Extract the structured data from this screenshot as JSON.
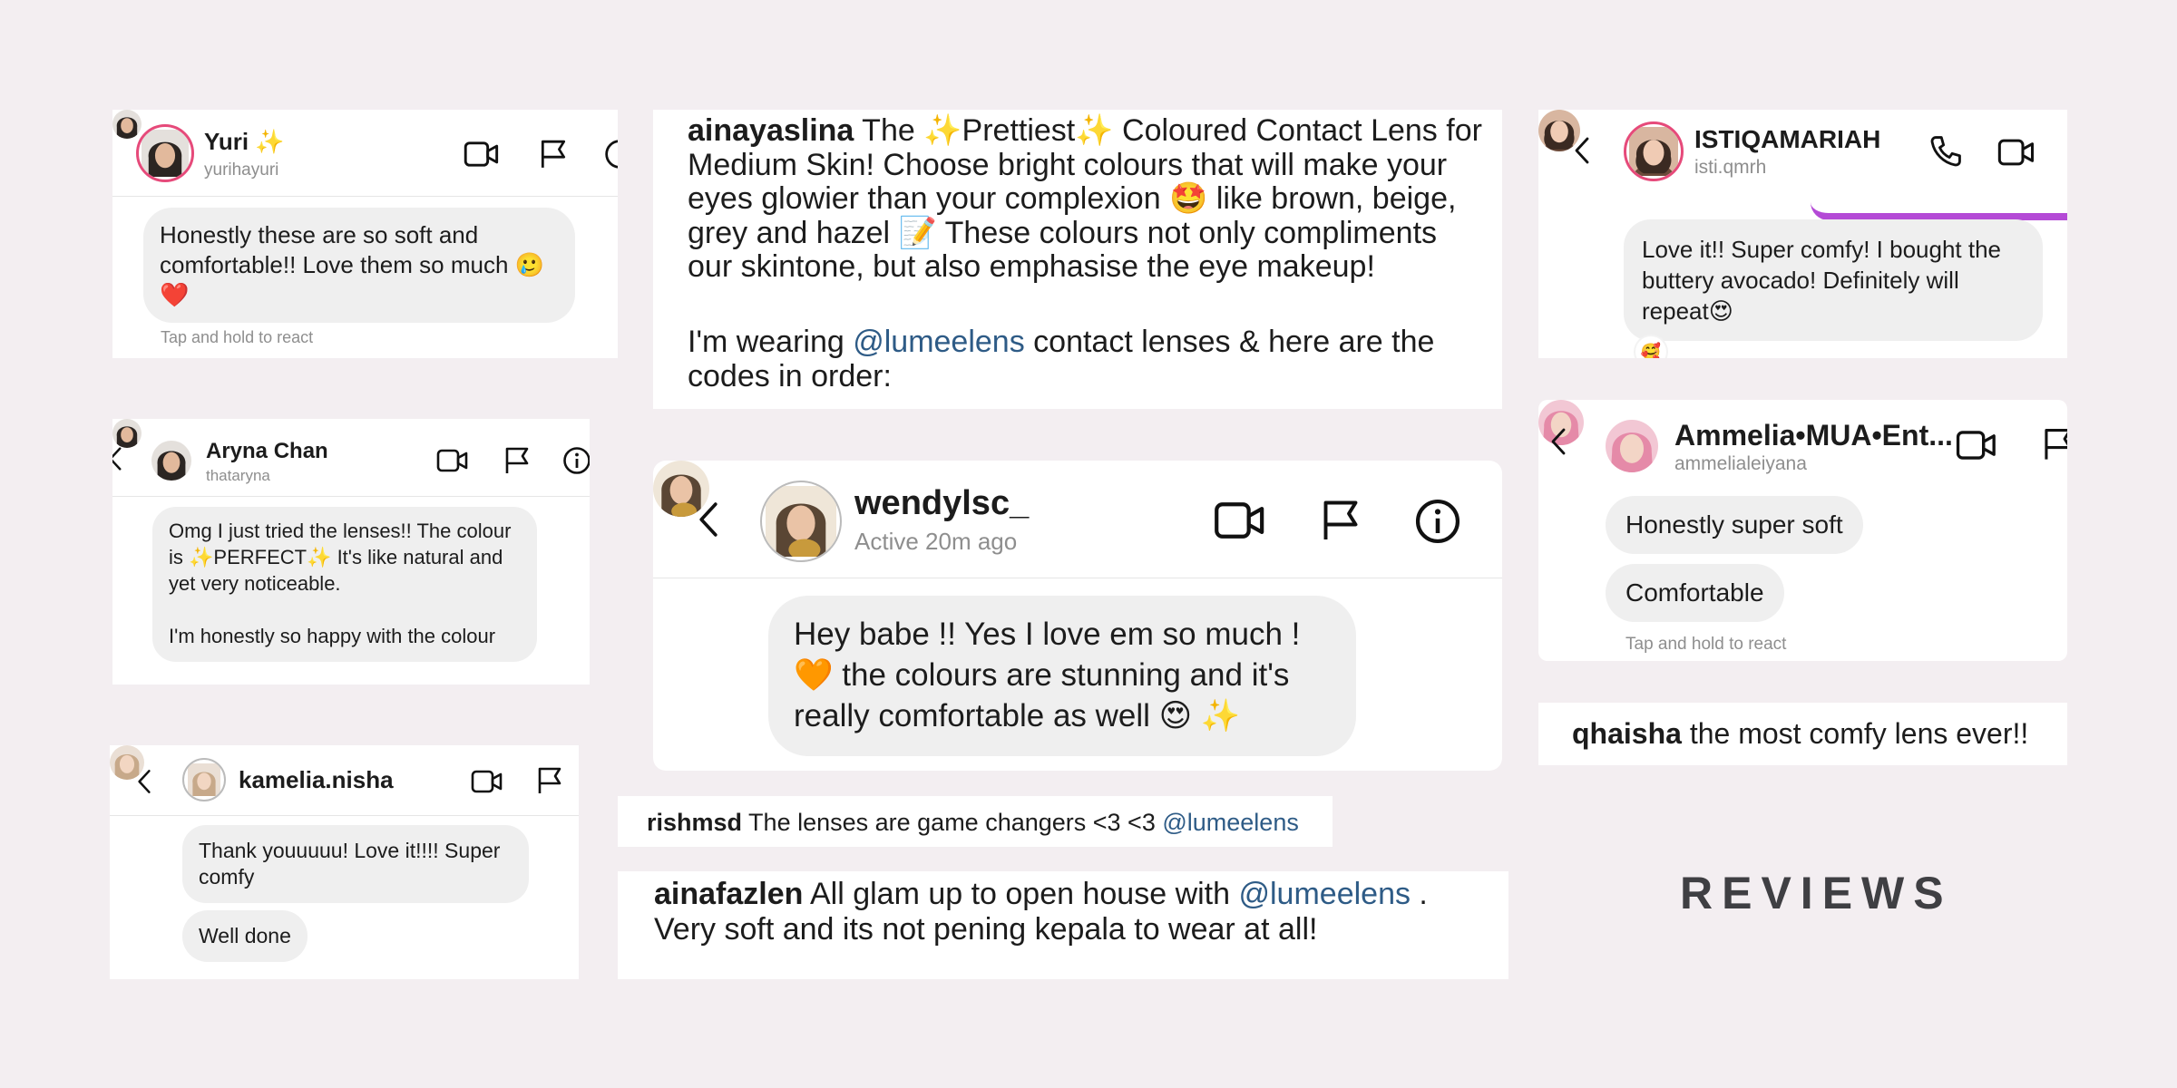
{
  "title": "REVIEWS",
  "yuri": {
    "name": "Yuri ✨",
    "handle": "yurihayuri",
    "message": "Honestly these are so soft and comfortable!! Love them so much 🥲 ❤️",
    "react_hint": "Tap and hold to react"
  },
  "aryna": {
    "name": "Aryna Chan",
    "handle": "thataryna",
    "message": "Omg I just tried the lenses!! The colour is ✨PERFECT✨ It's like natural and yet very noticeable.\n\nI'm honestly so happy with the colour"
  },
  "kamelia": {
    "name": "kamelia.nisha",
    "messages": [
      "Thank youuuuu! Love it!!!! Super comfy",
      "Well done"
    ]
  },
  "ainayaslina": {
    "user": "ainayaslina",
    "text_1": " The ✨Prettiest✨ Coloured Contact Lens for Medium Skin! Choose bright colours that will make your eyes glowier than your complexion 🤩 like brown, beige, grey and hazel 📝 These colours not only compliments our skintone, but also emphasise the eye makeup!",
    "text_2a": "I'm wearing ",
    "mention": "@lumeelens",
    "text_2b": " contact lenses & here are the codes in order:"
  },
  "wendy": {
    "name": "wendylsc_",
    "status": "Active 20m ago",
    "message": "Hey babe !! Yes I love em so much ! 🧡 the colours are stunning and it's really comfortable as well 😍 ✨"
  },
  "rishmsd": {
    "user": "rishmsd",
    "text": " The lenses are game changers <3 <3 ",
    "mention": "@lumeelens"
  },
  "ainafazlen": {
    "user": "ainafazlen",
    "text_1": " All glam up to open house with ",
    "mention": "@lumeelens",
    "text_2": " . Very soft and its not pening kepala to wear at all!"
  },
  "istiqa": {
    "name": "ISTIQAMARIAH",
    "handle": "isti.qmrh",
    "message": "Love it!! Super comfy! I bought the buttery avocado! Definitely will repeat😍",
    "reaction": "🥰"
  },
  "ammelia": {
    "name": "Ammelia•MUA•Ent...",
    "handle": "ammelialeiyana",
    "messages": [
      "Honestly super soft",
      "Comfortable"
    ],
    "react_hint": "Tap and hold to react"
  },
  "qhaisha": {
    "user": "qhaisha",
    "text": " the most comfy lens ever!!"
  },
  "colors": {
    "accent": "#b44ad6",
    "link": "#2e5b86",
    "bubble": "#efefef",
    "background": "#f3eef1"
  },
  "icons": [
    "back-icon",
    "video-call-icon",
    "flag-icon",
    "info-icon",
    "phone-icon"
  ]
}
